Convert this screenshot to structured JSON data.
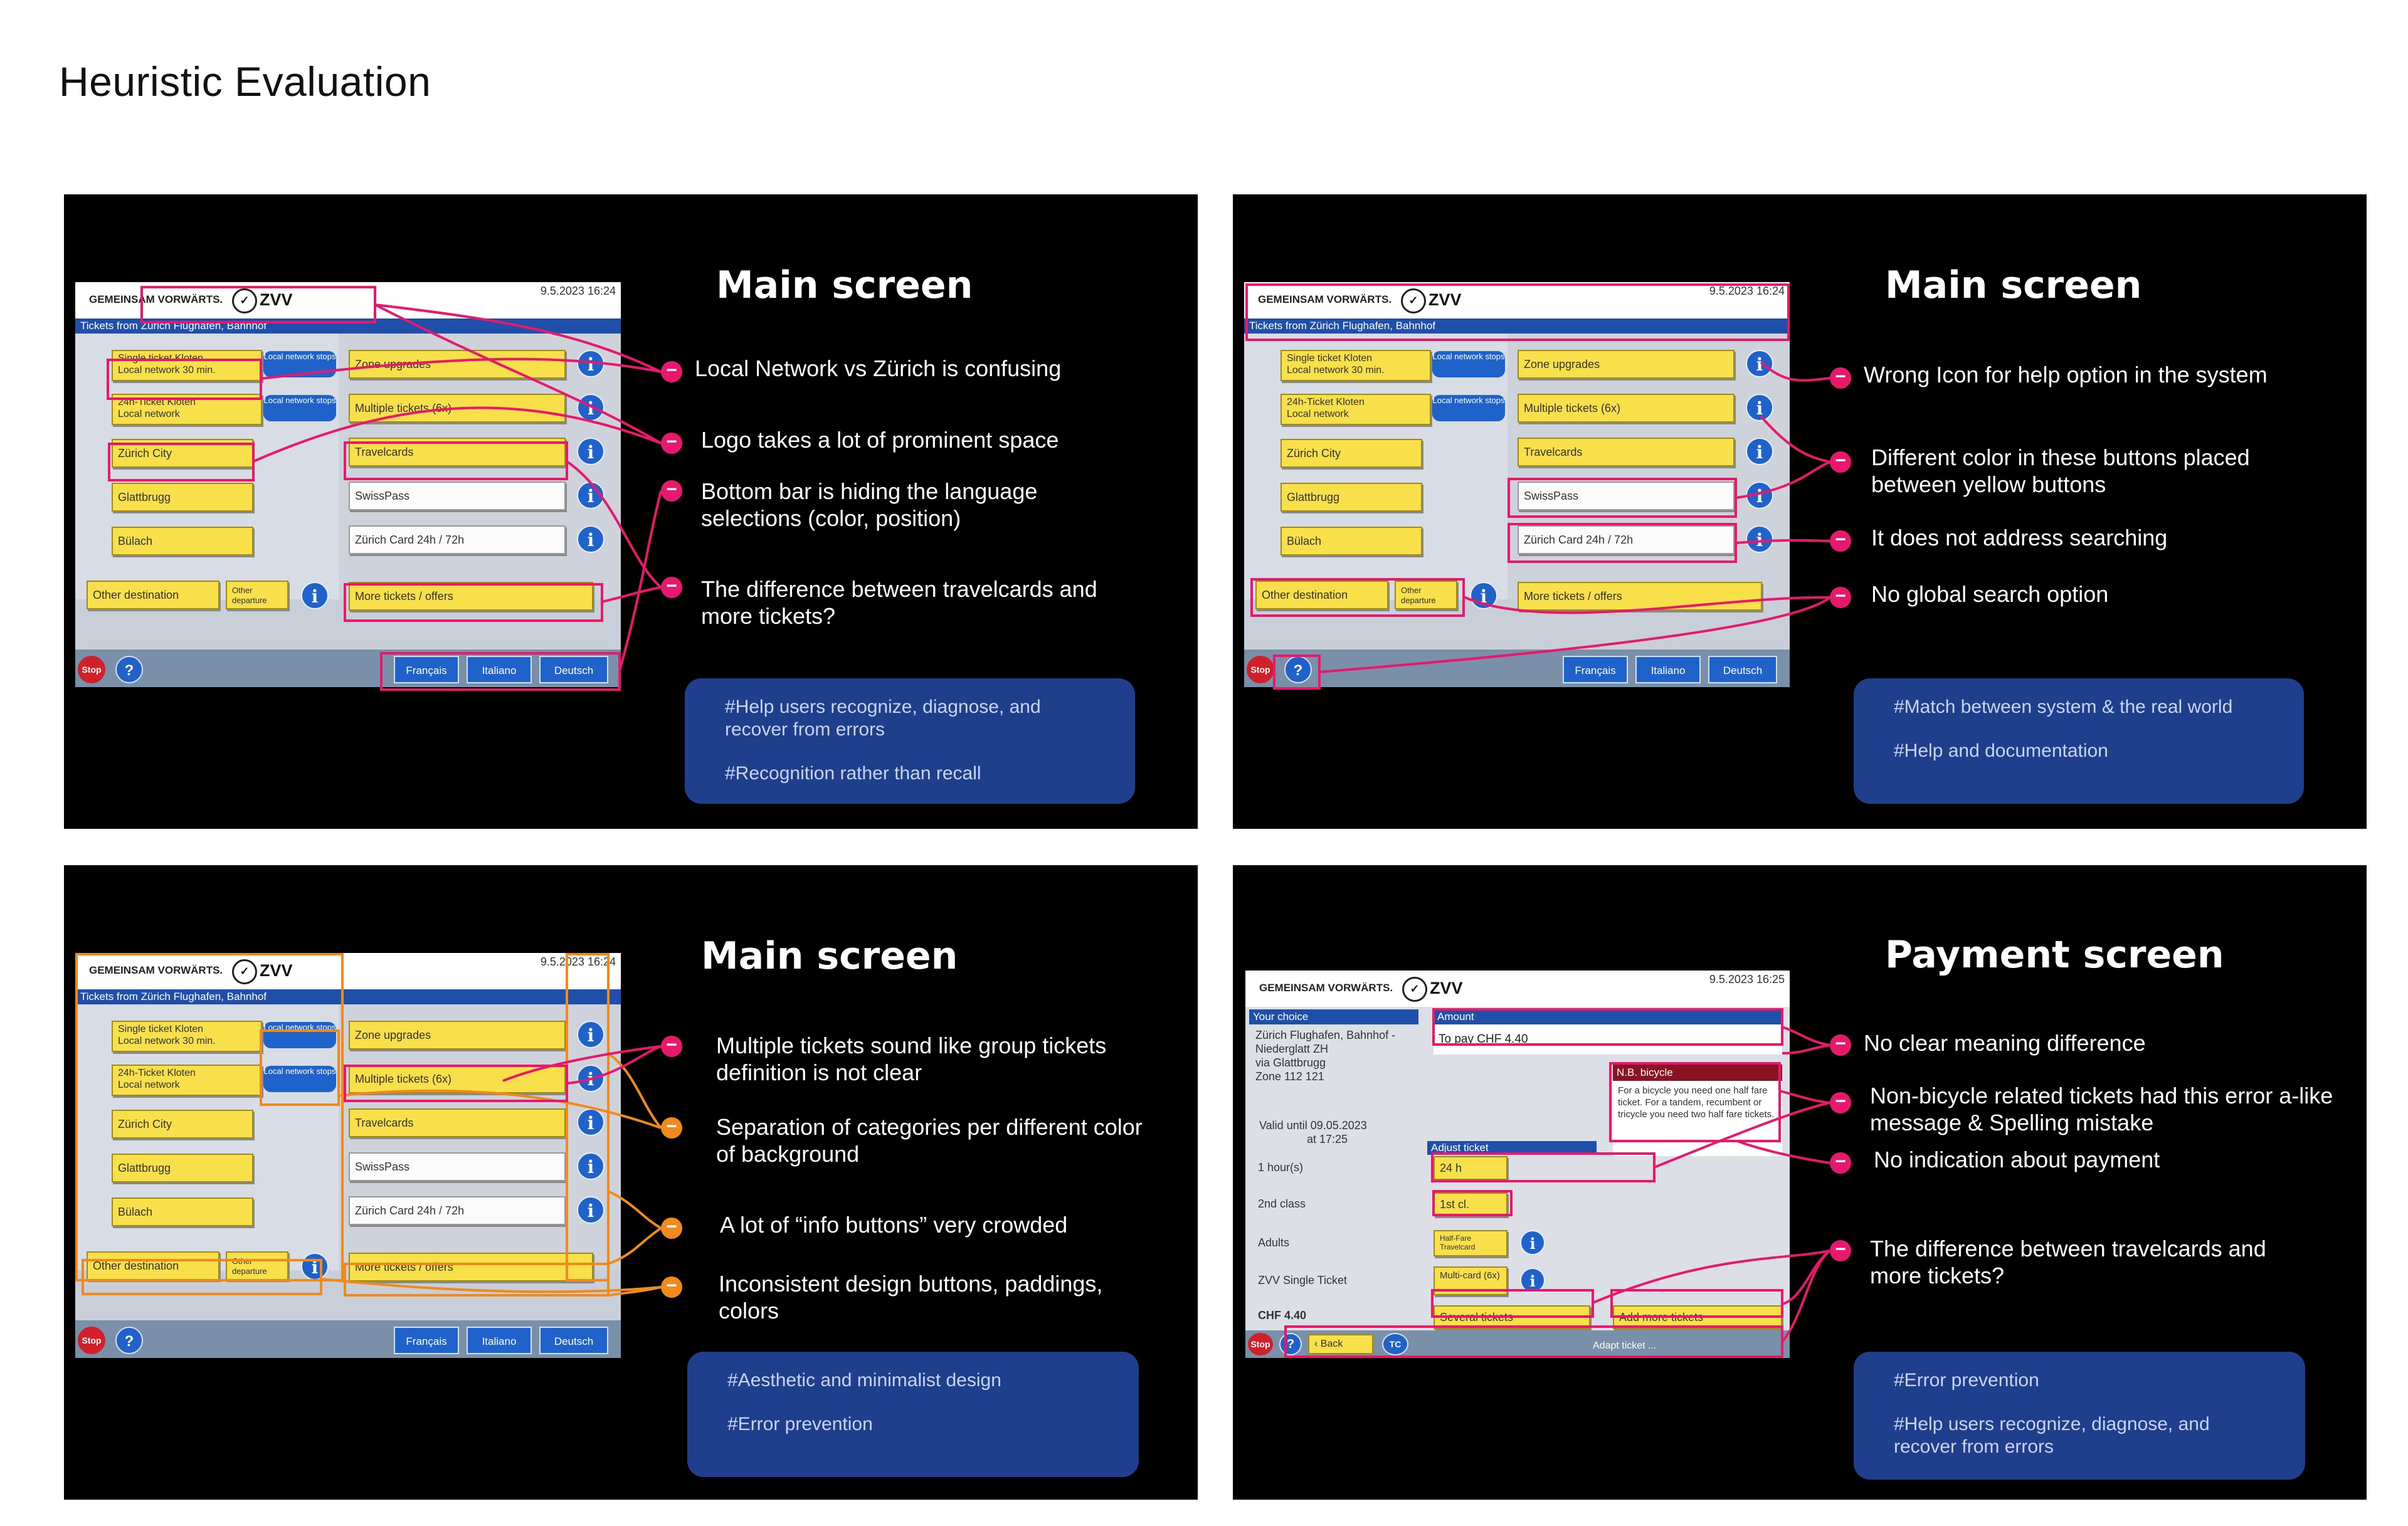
{
  "page_title": "Heuristic Evaluation",
  "colors": {
    "pink": "#e8196d",
    "orange": "#f08a1c",
    "tag_bg": "#1f3f8c",
    "panel_bg": "#000000"
  },
  "kiosk": {
    "logo_text": "GEMEINSAM VORWÄRTS.",
    "logo_brand": "ZVV",
    "date": "9.5.2023  16:24",
    "bar_title": "Tickets from Zürich Flughafen, Bahnhof",
    "single_ticket": [
      "Single ticket Kloten",
      "Local network 30 min."
    ],
    "ticket_24h": [
      "24h-Ticket Kloten",
      "Local network"
    ],
    "local_network_stops": "Local network stops",
    "zurich_city": "Zürich City",
    "glattbrugg": "Glattbrugg",
    "bulach": "Bülach",
    "other_destination": "Other destination",
    "other_departure": "Other departure",
    "zone_upgrades": "Zone upgrades",
    "multiple_tickets": "Multiple tickets (6x)",
    "travelcards": "Travelcards",
    "swisspass": "SwissPass",
    "zurich_card": "Zürich Card 24h / 72h",
    "more_tickets": "More tickets / offers",
    "stop": "Stop",
    "help": "?",
    "info": "i",
    "lang_fr": "Français",
    "lang_it": "Italiano",
    "lang_de": "Deutsch"
  },
  "panels": [
    {
      "title": "Main screen",
      "notes": [
        "Local Network vs Zürich is confusing",
        "Logo takes a lot of prominent space",
        "Bottom bar is hiding the language selections (color, position)",
        "The difference between travelcards and more tickets?"
      ],
      "tags": [
        "#Help users recognize, diagnose, and recover from errors",
        "#Recognition rather than recall"
      ]
    },
    {
      "title": "Main screen",
      "notes": [
        "Wrong Icon for help option in the system",
        "Different color in these buttons placed between yellow buttons",
        "It does not address searching",
        "No global search option"
      ],
      "tags": [
        "#Match between system & the real world",
        "#Help and documentation"
      ]
    },
    {
      "title": "Main screen",
      "notes": [
        "Multiple tickets sound like group tickets definition is not clear",
        "Separation of categories per different color of background",
        "A lot of “info buttons” very crowded",
        "Inconsistent design buttons, paddings, colors"
      ],
      "tags": [
        "#Aesthetic and minimalist design",
        "#Error prevention"
      ]
    },
    {
      "title": "Payment screen",
      "notes": [
        "No clear meaning difference",
        "Non-bicycle related tickets had this error a-like message & Spelling mistake",
        "No indication about payment",
        "The difference between travelcards and more tickets?"
      ],
      "tags": [
        "#Error prevention",
        "#Help users recognize, diagnose, and recover from errors"
      ]
    }
  ],
  "payment": {
    "date": "9.5.2023  16:25",
    "your_choice": "Your choice",
    "route": [
      "Zürich Flughafen, Bahnhof -",
      "Niederglatt ZH",
      "via Glattbrugg",
      "Zone 112 121"
    ],
    "valid_until": [
      "Valid until 09.05.2023",
      "at 17:25"
    ],
    "amount_label": "Amount",
    "to_pay": "To pay  CHF  4.40",
    "nb_title": "N.B. bicycle",
    "nb_text": "For a bicycle you need one half fare ticket. For a tandem, recumbent or tricycle you need two half fare tickets.",
    "adjust_ticket": "Adjust ticket",
    "duration_label": "1 hour(s)",
    "duration_value": "24 h",
    "class_label": "2nd class",
    "class_value": "1st cl.",
    "adults_label": "Adults",
    "halffare_value": "Half-Fare Travelcard",
    "ticket_label": "ZVV Single Ticket",
    "multicard_value": "Multi-card (6x)",
    "price": "CHF  4.40",
    "several_tickets": "Several tickets",
    "add_more_tickets": "Add more tickets",
    "back": "Back",
    "tc": "TC",
    "adapt_ticket": "Adapt ticket  ..."
  }
}
